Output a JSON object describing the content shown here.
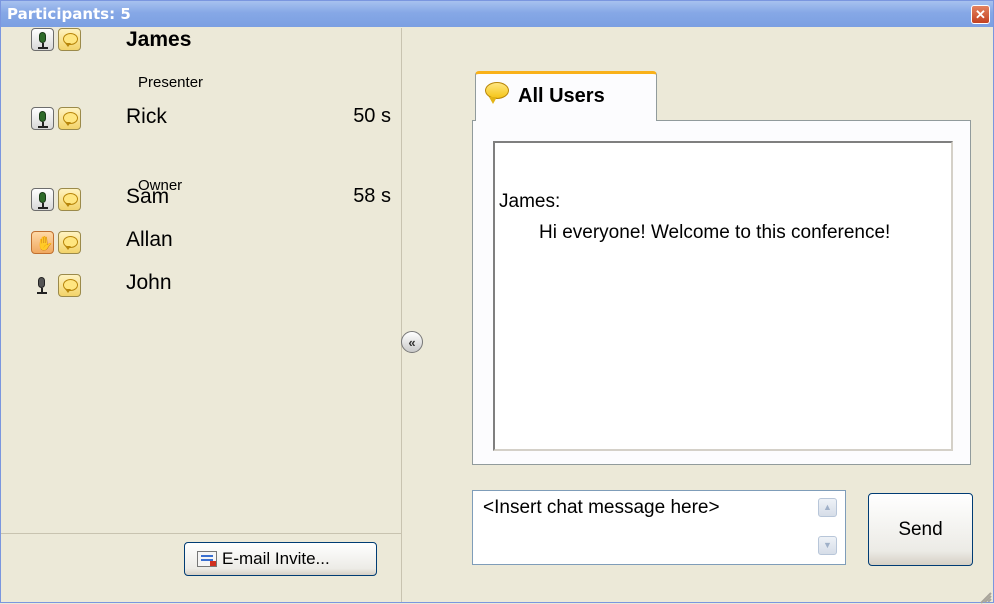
{
  "window": {
    "title": "Participants: 5",
    "close_icon": "close-icon"
  },
  "participants": [
    {
      "name": "James",
      "bold": true,
      "role": "Presenter",
      "time": "",
      "status_icon": "microphone-icon",
      "chat_icon": "chat-bubble-icon"
    },
    {
      "name": "Rick",
      "bold": false,
      "role": "Owner",
      "time": "50 s",
      "status_icon": "microphone-icon",
      "chat_icon": "chat-bubble-icon"
    },
    {
      "name": "Sam",
      "bold": false,
      "role": "",
      "time": "58 s",
      "status_icon": "microphone-icon",
      "chat_icon": "chat-bubble-icon"
    },
    {
      "name": "Allan",
      "bold": false,
      "role": "",
      "time": "",
      "status_icon": "raised-hand-icon",
      "chat_icon": "chat-bubble-icon"
    },
    {
      "name": "John",
      "bold": false,
      "role": "",
      "time": "",
      "status_icon": "microphone-muted-icon",
      "chat_icon": "chat-bubble-icon"
    }
  ],
  "left_footer": {
    "email_invite_label": "E-mail Invite..."
  },
  "collapse_button": "«",
  "chat": {
    "tab_label": "All Users",
    "sender": "James:",
    "message": "Hi everyone! Welcome to this conference!",
    "input_placeholder": "<Insert chat message here>",
    "send_label": "Send"
  },
  "colors": {
    "titlebar": "#86a8e6",
    "tab_accent": "#f9b119",
    "background": "#ece9d8"
  }
}
